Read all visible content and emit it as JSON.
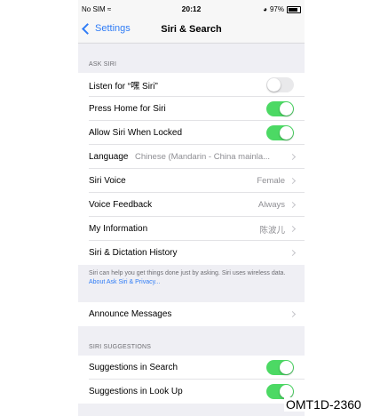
{
  "status_bar": {
    "carrier": "No SIM",
    "time": "20:12",
    "battery": "97%"
  },
  "nav": {
    "back_label": "Settings",
    "title": "Siri & Search"
  },
  "ask_siri": {
    "header": "ASK SIRI",
    "rows": [
      {
        "label": "Listen for “嘿 Siri”",
        "type": "toggle",
        "on": false
      },
      {
        "label": "Press Home for Siri",
        "type": "toggle",
        "on": true
      },
      {
        "label": "Allow Siri When Locked",
        "type": "toggle",
        "on": true
      },
      {
        "label": "Language",
        "value": "Chinese (Mandarin - China mainla...",
        "type": "disclosure"
      },
      {
        "label": "Siri Voice",
        "value": "Female",
        "type": "disclosure"
      },
      {
        "label": "Voice Feedback",
        "value": "Always",
        "type": "disclosure"
      },
      {
        "label": "My Information",
        "value": "陈波儿",
        "type": "disclosure"
      },
      {
        "label": "Siri & Dictation History",
        "value": "",
        "type": "disclosure"
      }
    ],
    "footer_text": "Siri can help you get things done just by asking. Siri uses wireless data.",
    "footer_link": "About Ask Siri & Privacy..."
  },
  "announce": {
    "label": "Announce Messages"
  },
  "siri_suggestions": {
    "header": "SIRI SUGGESTIONS",
    "rows": [
      {
        "label": "Suggestions in Search",
        "on": true
      },
      {
        "label": "Suggestions in Look Up",
        "on": true
      }
    ]
  },
  "watermark": "OMT1D-2360",
  "colors": {
    "accent": "#2f7cf6",
    "toggle_on": "#4cd964",
    "background": "#efeff4"
  }
}
